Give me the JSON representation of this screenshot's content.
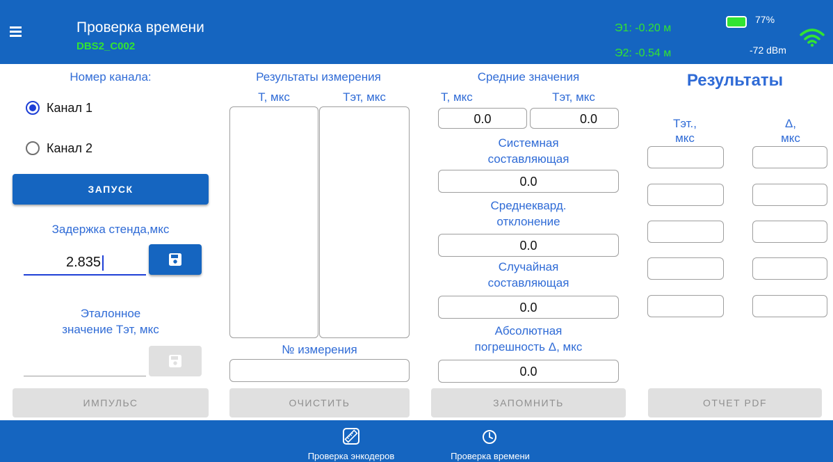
{
  "header": {
    "title": "Проверка времени",
    "device": "DBS2_C002",
    "e1": "Э1: -0.20 м",
    "e2": "Э2: -0.54 м",
    "battery_pct": "77%",
    "signal": "-72 dBm",
    "colors": {
      "bar": "#1565c0",
      "accent": "#32e432"
    }
  },
  "left": {
    "channel_label": "Номер канала:",
    "channel1": "Канал 1",
    "channel2": "Канал 2",
    "start_button": "ЗАПУСК",
    "delay_label": "Задержка стенда,мкс",
    "delay_value": "2.835",
    "ref_label_1": "Эталонное",
    "ref_label_2": "значение Тэт, мкс",
    "ref_value": "",
    "impulse_button": "ИМПУЛЬС"
  },
  "measure": {
    "title": "Результаты измерения",
    "col_t": "Т, мкс",
    "col_tet": "Тэт, мкс",
    "number_label": "№ измерения",
    "number_value": "",
    "clear_button": "ОЧИСТИТЬ"
  },
  "avg": {
    "title": "Средние значения",
    "col_t": "Т, мкс",
    "col_tet": "Тэт, мкс",
    "t_value": "0.0",
    "tet_value": "0.0",
    "sys_label_1": "Системная",
    "sys_label_2": "составляющая",
    "sys_value": "0.0",
    "std_label_1": "Среднекв​ард.",
    "std_label_2": "отклонение",
    "std_value": "0.0",
    "rnd_label_1": "Случайная",
    "rnd_label_2": "составляющая",
    "rnd_value": "0.0",
    "abs_label_1": "Абсолютная",
    "abs_label_2": "погрешность Δ, мкс",
    "abs_value": "0.0",
    "save_button": "ЗАПОМНИТЬ"
  },
  "results": {
    "title": "Результаты",
    "col_tet_1": "Тэт.,",
    "col_tet_2": "мкс",
    "col_delta_1": "Δ,",
    "col_delta_2": "мкс",
    "pdf_button": "ОТЧЕТ PDF"
  },
  "nav": {
    "encoders": "Проверка энкодеров",
    "time": "Проверка времени"
  }
}
